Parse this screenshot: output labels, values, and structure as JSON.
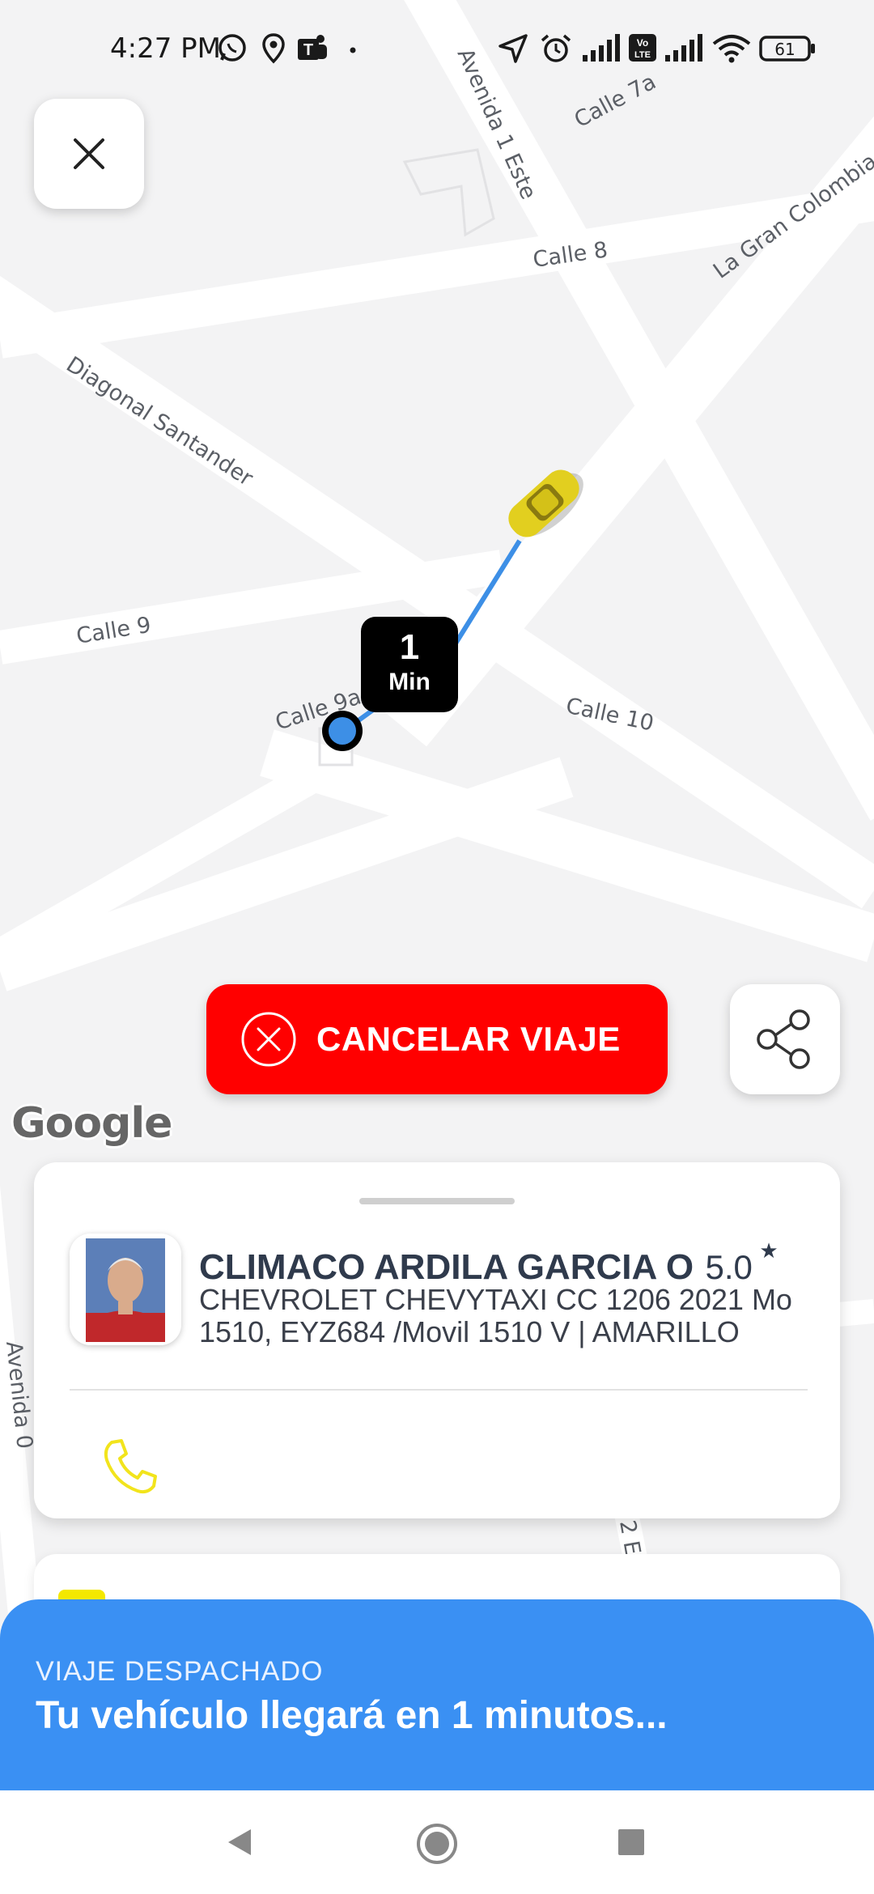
{
  "status_bar": {
    "time": "4:27 PM",
    "battery": "61",
    "icons": [
      "whatsapp-icon",
      "location-pin-icon",
      "teams-icon",
      "navigation-arrow-icon",
      "alarm-icon",
      "signal-icon",
      "volte-icon",
      "wifi-icon",
      "battery-icon"
    ]
  },
  "map": {
    "street_labels": {
      "avenida_1_este": "Avenida 1 Este",
      "calle_7a": "Calle 7a",
      "la_gran_colombia": "La Gran Colombia",
      "calle_8": "Calle 8",
      "diagonal_santander": "Diagonal Santander",
      "calle_9": "Calle 9",
      "calle_9a": "Calle 9a",
      "calle_10": "Calle 10",
      "avenida_0": "Avenida 0",
      "fragment_2e": "2 E"
    },
    "attribution": "Google"
  },
  "eta_marker": {
    "value": "1",
    "unit": "Min"
  },
  "actions": {
    "cancel_label": "CANCELAR VIAJE",
    "close_icon": "close-icon",
    "share_icon": "share-icon"
  },
  "driver": {
    "name": "CLIMACO ARDILA GARCIA O",
    "rating": "5.0",
    "rating_symbol": "★",
    "vehicle_line1": "CHEVROLET CHEVYTAXI CC 1206 2021 Mo",
    "vehicle_line2": "1510, EYZ684 /Movil 1510 V | AMARILLO"
  },
  "trip_status": {
    "label": "VIAJE DESPACHADO",
    "message": "Tu vehículo llegará en 1 minutos..."
  },
  "colors": {
    "cancel": "#ff0000",
    "status_panel": "#3a90f3",
    "route": "#3d8fe6",
    "phone_icon": "#f2e41c",
    "taxi": "#e2cf1f"
  }
}
